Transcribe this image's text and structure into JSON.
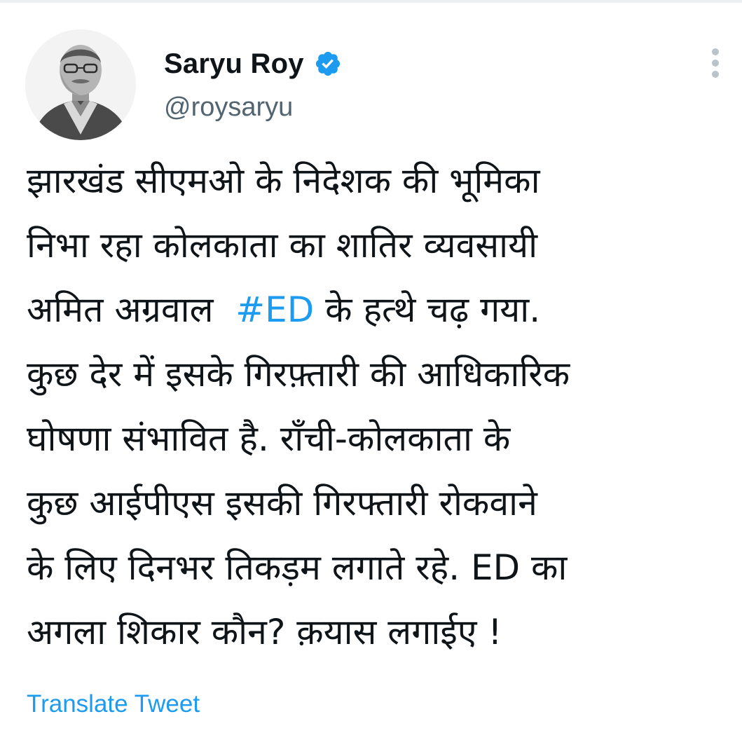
{
  "author": {
    "display_name": "Saryu Roy",
    "handle": "@roysaryu",
    "verified": true
  },
  "tweet": {
    "lines": [
      {
        "before": "झारखंड सीएमओ के निदेशक की भूमिका",
        "hashtag": "",
        "after": ""
      },
      {
        "before": "निभा रहा कोलकाता का शातिर व्यवसायी",
        "hashtag": "",
        "after": ""
      },
      {
        "before": "अमित अग्रवाल  ",
        "hashtag": "#ED",
        "after": " के हत्थे चढ़ गया."
      },
      {
        "before": "कुछ देर में इसके गिरफ़्तारी की आधिकारिक",
        "hashtag": "",
        "after": ""
      },
      {
        "before": "घोषणा संभावित है. राँची-कोलकाता के",
        "hashtag": "",
        "after": ""
      },
      {
        "before": "कुछ आईपीएस इसकी गिरफ्तारी रोकवाने",
        "hashtag": "",
        "after": ""
      },
      {
        "before": "के लिए दिनभर तिकड़म लगाते रहे. ED का",
        "hashtag": "",
        "after": ""
      },
      {
        "before": "अगला शिकार कौन? क़यास लगाईए !",
        "hashtag": "",
        "after": ""
      }
    ]
  },
  "actions": {
    "translate_label": "Translate Tweet"
  },
  "icons": {
    "avatar": "avatar-photo",
    "verified": "verified-badge-icon",
    "more": "more-options-icon"
  },
  "colors": {
    "accent": "#1d9bf0",
    "text": "#0f1419",
    "secondary_text": "#536471"
  }
}
